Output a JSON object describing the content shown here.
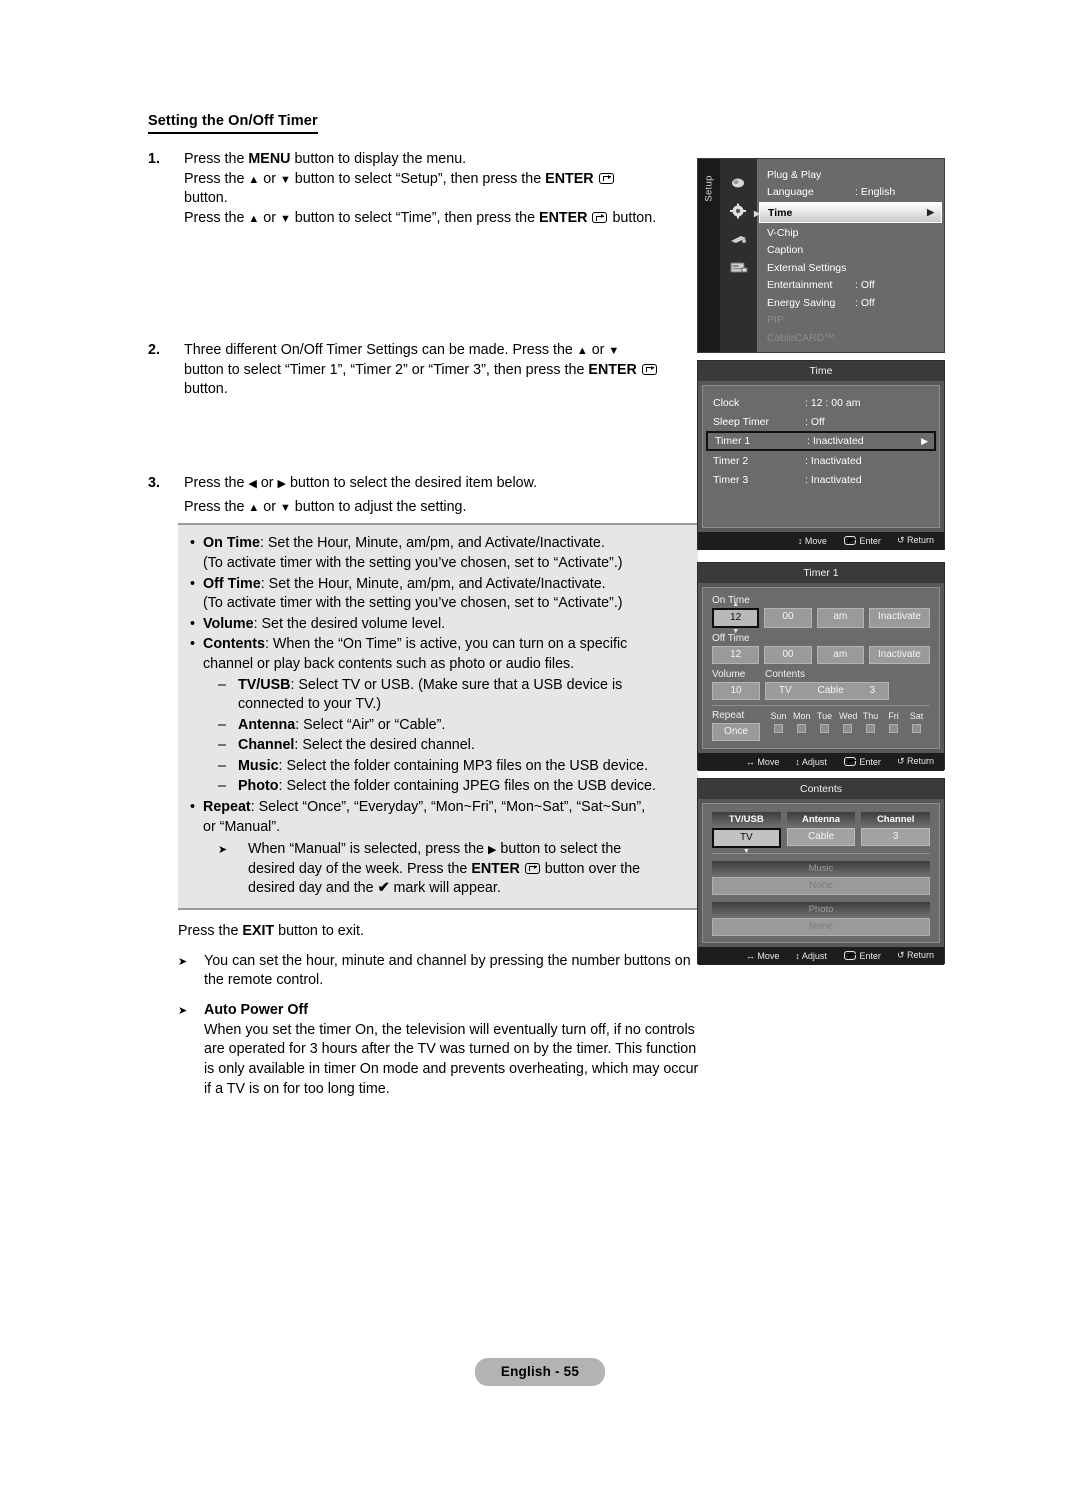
{
  "document": {
    "section_title": "Setting the On/Off Timer",
    "steps": [
      {
        "num": "1.",
        "lines": [
          "Press the MENU button to display the menu.",
          "Press the ▲ or ▼ button to select “Setup”, then press the ENTER ⏎ button.",
          "Press the ▲ or ▼ button to select “Time”, then press the ENTER ⏎ button."
        ]
      },
      {
        "num": "2.",
        "lines": [
          "Three different On/Off Timer Settings can be made. Press the ▲ or ▼ button to select “Timer 1”, “Timer 2” or “Timer 3”, then press the ENTER ⏎ button."
        ]
      },
      {
        "num": "3.",
        "lines": [
          "Press the ◀ or ▶ button to select the desired item below.",
          "Press the ▲ or ▼ button to adjust the setting."
        ]
      }
    ],
    "step1": {
      "l1_a": "Press the ",
      "l1_menu": "MENU",
      "l1_b": " button to display the menu.",
      "l2_a": "Press the ",
      "l2_b": " or ",
      "l2_c": " button to select “Setup”, then press the ",
      "l2_enter": "ENTER",
      "l3": "button.",
      "l4_a": "Press the ",
      "l4_b": " or ",
      "l4_c": " button to select “Time”, then press the ",
      "l4_enter": "ENTER",
      "l4_d": " button."
    },
    "step2": {
      "l1_a": "Three different On/Off Timer Settings can be made. Press the ",
      "l1_b": " or ",
      "l2_a": "button to select “Timer 1”, “Timer 2” or “Timer 3”, then press the ",
      "l2_enter": "ENTER",
      "l3": "button."
    },
    "step3": {
      "l1_a": "Press the ",
      "l1_b": " or ",
      "l1_c": " button to select the desired item below.",
      "l2_a": "Press the ",
      "l2_b": " or ",
      "l2_c": " button to adjust the setting."
    },
    "greybox": {
      "items": [
        {
          "bullet": "•",
          "term": "On Time",
          "rest": ": Set the Hour, Minute, am/pm, and Activate/Inactivate.",
          "sub": "(To activate timer with the setting you’ve chosen, set to “Activate”.)"
        },
        {
          "bullet": "•",
          "term": "Off Time",
          "rest": ": Set the Hour, Minute, am/pm, and Activate/Inactivate.",
          "sub": "(To activate timer with the setting you’ve chosen, set to “Activate”.)"
        },
        {
          "bullet": "•",
          "term": "Volume",
          "rest": ": Set the desired volume level.",
          "sub": ""
        },
        {
          "bullet": "•",
          "term": "Contents",
          "rest": ": When the “On Time” is active, you can turn on a specific",
          "sub": "channel or play back contents such as photo or audio files."
        }
      ],
      "subitems": [
        {
          "dash": "–",
          "term": "TV/USB",
          "rest": ": Select TV or USB. (Make sure that a USB device is",
          "cont": "connected to your TV.)"
        },
        {
          "dash": "–",
          "term": "Antenna",
          "rest": ": Select “Air” or “Cable”.",
          "cont": ""
        },
        {
          "dash": "–",
          "term": "Channel",
          "rest": ": Select the desired channel.",
          "cont": ""
        },
        {
          "dash": "–",
          "term": "Music",
          "rest": ": Select the folder containing MP3 files on the USB device.",
          "cont": ""
        },
        {
          "dash": "–",
          "term": "Photo",
          "rest": ": Select the folder containing JPEG files on the USB device.",
          "cont": ""
        }
      ],
      "repeat": {
        "bullet": "•",
        "term": "Repeat",
        "rest": ": Select “Once”, “Everyday”, “Mon~Fri”, “Mon~Sat”, “Sat~Sun”,",
        "cont": "or “Manual”."
      },
      "manual_note": {
        "l1_a": "When “Manual” is selected, press the ",
        "l1_b": " button to select the",
        "l2_a": "desired day of the week. Press the ",
        "l2_enter": "ENTER",
        "l2_b": " button over the",
        "l3_a": "desired day and the ",
        "l3_check": "✔",
        "l3_b": " mark will appear."
      }
    },
    "after": {
      "exit_a": "Press the ",
      "exit_b": "EXIT",
      "exit_c": " button to exit.",
      "note1": "You can set the hour, minute and channel by pressing the number buttons on the remote control.",
      "note2_title": "Auto Power Off",
      "note2_body": "When you set the timer On, the television will eventually turn off, if no controls are operated for 3 hours after the TV was turned on by the timer. This function is only available in timer On mode and prevents overheating, which may occur if a TV is on for too long time."
    }
  },
  "osd": {
    "setup_menu": {
      "rail_label": "Setup",
      "rows": [
        {
          "name": "Plug & Play",
          "value": "",
          "state": "normal"
        },
        {
          "name": "Language",
          "value": ": English",
          "state": "normal"
        },
        {
          "name": "Time",
          "value": "",
          "state": "selected"
        },
        {
          "name": "V-Chip",
          "value": "",
          "state": "normal"
        },
        {
          "name": "Caption",
          "value": "",
          "state": "normal"
        },
        {
          "name": "External Settings",
          "value": "",
          "state": "normal"
        },
        {
          "name": "Entertainment",
          "value": ": Off",
          "state": "normal"
        },
        {
          "name": "Energy Saving",
          "value": ": Off",
          "state": "normal"
        },
        {
          "name": "PIP",
          "value": "",
          "state": "dim"
        },
        {
          "name": "CableCARD™",
          "value": "",
          "state": "dim"
        }
      ]
    },
    "time_menu": {
      "title": "Time",
      "rows": [
        {
          "name": "Clock",
          "value": ": 12 : 00  am",
          "state": "normal"
        },
        {
          "name": "Sleep Timer",
          "value": ": Off",
          "state": "normal"
        },
        {
          "name": "Timer 1",
          "value": ": Inactivated",
          "state": "selected"
        },
        {
          "name": "Timer 2",
          "value": ": Inactivated",
          "state": "normal"
        },
        {
          "name": "Timer 3",
          "value": ": Inactivated",
          "state": "normal"
        }
      ],
      "footer": [
        {
          "glyph": "↕",
          "label": "Move"
        },
        {
          "glyph": "enter",
          "label": "Enter"
        },
        {
          "glyph": "↺",
          "label": "Return"
        }
      ]
    },
    "timer1": {
      "title": "Timer 1",
      "on_time_label": "On Time",
      "on_time": {
        "hour": "12",
        "minute": "00",
        "ampm": "am",
        "activate": "Inactivate"
      },
      "off_time_label": "Off Time",
      "off_time": {
        "hour": "12",
        "minute": "00",
        "ampm": "am",
        "activate": "Inactivate"
      },
      "volume_label": "Volume",
      "volume": "10",
      "contents_label": "Contents",
      "contents": {
        "source": "TV",
        "antenna": "Cable",
        "channel": "3"
      },
      "repeat_label": "Repeat",
      "repeat": "Once",
      "days": [
        "Sun",
        "Mon",
        "Tue",
        "Wed",
        "Thu",
        "Fri",
        "Sat"
      ],
      "footer": [
        {
          "glyph": "↔",
          "label": "Move"
        },
        {
          "glyph": "↕",
          "label": "Adjust"
        },
        {
          "glyph": "enter",
          "label": "Enter"
        },
        {
          "glyph": "↺",
          "label": "Return"
        }
      ]
    },
    "contents_menu": {
      "title": "Contents",
      "columns": [
        {
          "head": "TV/USB",
          "value": "TV",
          "state": "selected"
        },
        {
          "head": "Antenna",
          "value": "Cable",
          "state": "normal"
        },
        {
          "head": "Channel",
          "value": "3",
          "state": "normal"
        }
      ],
      "blocks": [
        {
          "head": "Music",
          "value": "None"
        },
        {
          "head": "Photo",
          "value": "None"
        }
      ],
      "footer": [
        {
          "glyph": "↔",
          "label": "Move"
        },
        {
          "glyph": "↕",
          "label": "Adjust"
        },
        {
          "glyph": "enter",
          "label": "Enter"
        },
        {
          "glyph": "↺",
          "label": "Return"
        }
      ]
    }
  },
  "footer": {
    "page_label": "English - 55"
  }
}
